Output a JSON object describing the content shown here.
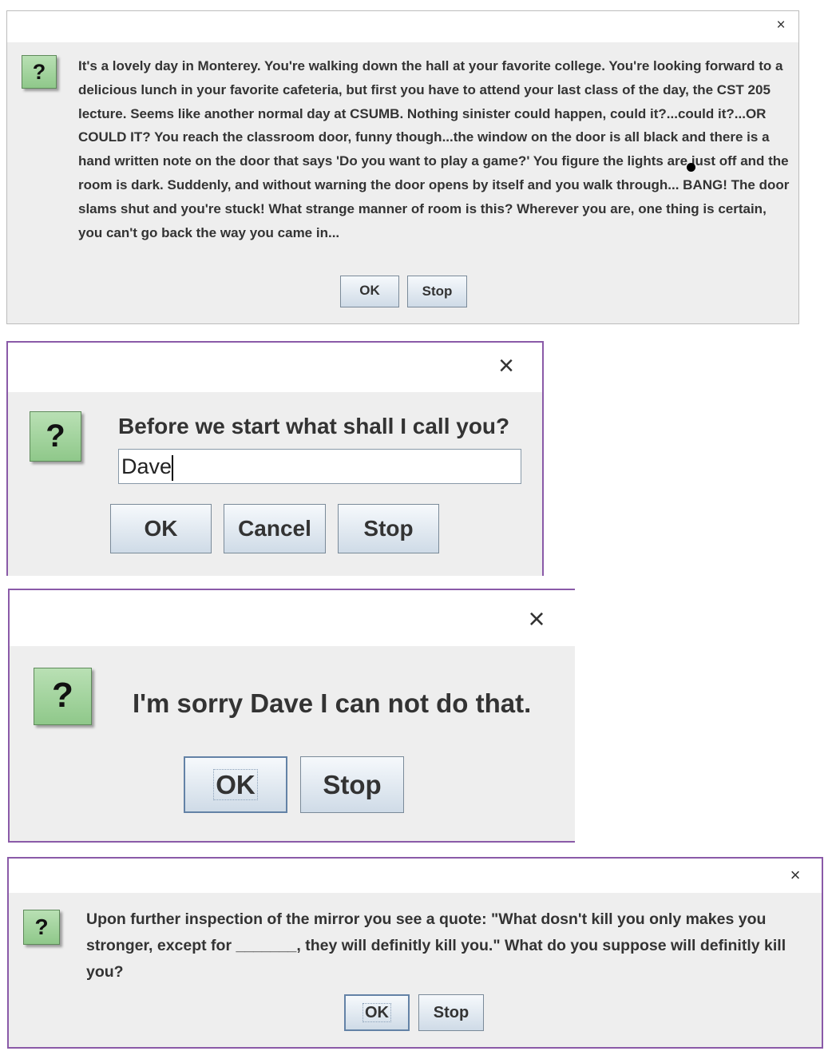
{
  "dialog1": {
    "close_glyph": "×",
    "icon_glyph": "?",
    "message": "It's a lovely day in Monterey.  You're walking down the hall at your favorite college. You're looking forward to a delicious lunch in your favorite cafeteria, but first you have to attend your last class of the day, the CST 205 lecture. Seems like another normal day at CSUMB. Nothing sinister could happen, could it?...could it?...OR COULD IT? You reach the classroom door, funny though...the window on the door is all black and there is a hand written note on the door that says 'Do you want to play a game?' You figure the lights are just off and the room is dark.  Suddenly, and without warning the door opens by itself and you walk through... BANG! The door slams shut and you're stuck!  What strange manner of room is this? Wherever you are, one thing is certain, you can't go back the way you came in...",
    "ok_label": "OK",
    "stop_label": "Stop"
  },
  "dialog2": {
    "close_glyph": "×",
    "icon_glyph": "?",
    "prompt": "Before we start what shall I call you?",
    "input_value": "Dave",
    "ok_label": "OK",
    "cancel_label": "Cancel",
    "stop_label": "Stop"
  },
  "dialog3": {
    "close_glyph": "×",
    "icon_glyph": "?",
    "message": "I'm sorry Dave I can not do that.",
    "ok_label": "OK",
    "stop_label": "Stop"
  },
  "dialog4": {
    "close_glyph": "×",
    "icon_glyph": "?",
    "message": "Upon further inspection of the mirror you see a quote: \"What dosn't kill you only makes you stronger, except for _______, they will definitly kill you.\" What do you suppose will definitly kill you?",
    "ok_label": "OK",
    "stop_label": "Stop"
  },
  "colors": {
    "dialog_bg": "#eeeeee",
    "frame_border": "#8a5aa8",
    "icon_green": "#8fc88a",
    "button_top": "#f6f9fc",
    "button_bottom": "#cfdbe7"
  }
}
